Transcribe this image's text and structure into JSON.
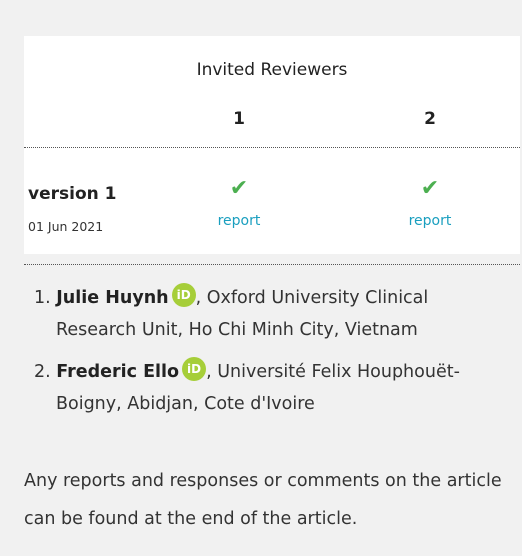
{
  "panel": {
    "title": "Invited Reviewers",
    "columns": [
      "1",
      "2"
    ],
    "version_label": "version 1",
    "version_date": "01 Jun 2021",
    "report_links": [
      "report",
      "report"
    ],
    "check_icon": "checkmark-icon",
    "check_color": "#4caf50",
    "link_color": "#1a9fbf"
  },
  "reviewers": [
    {
      "number": "1.",
      "name": "Julie Huynh",
      "affiliation": ", Oxford University Clinical Research Unit, Ho Chi Minh City, Vietnam",
      "orcid_label": "iD"
    },
    {
      "number": "2.",
      "name": "Frederic Ello",
      "affiliation": ", Université Felix Houphouët-Boigny, Abidjan, Cote d'Ivoire",
      "orcid_label": "iD"
    }
  ],
  "footer": {
    "text": "Any reports and responses or comments on the article can be found at the end of the article."
  }
}
